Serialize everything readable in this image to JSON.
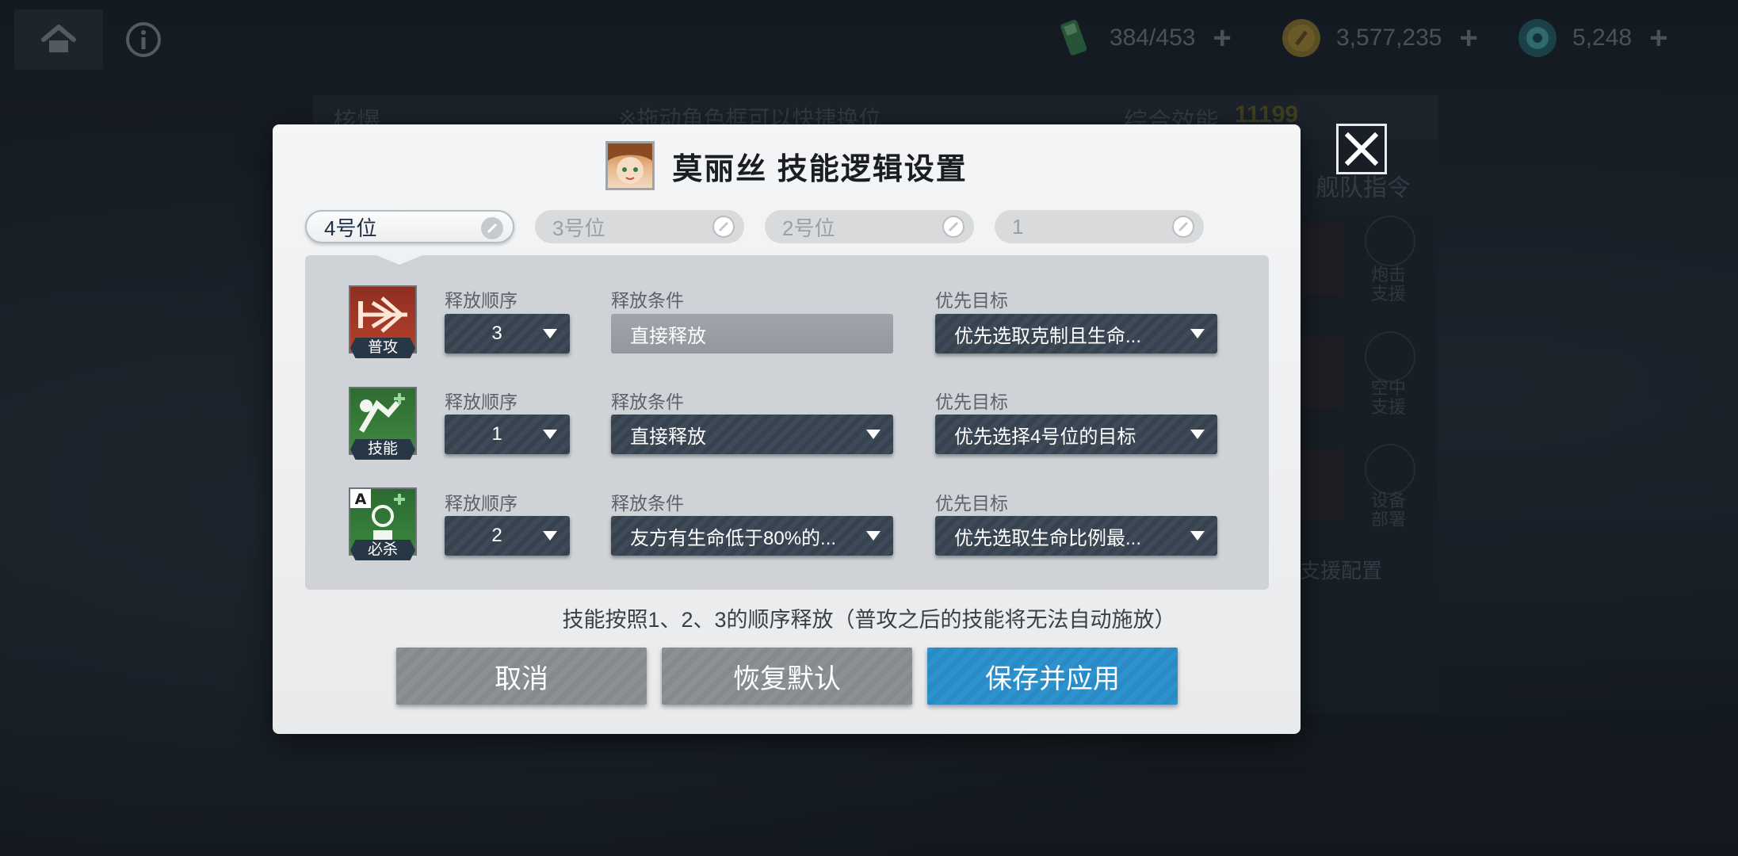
{
  "topbar": {
    "stamina": "384/453",
    "coins": "3,577,235",
    "gems": "5,248",
    "plus": "+"
  },
  "background": {
    "team_name": "核爆",
    "drag_hint": "※拖动角色框可以快捷换位",
    "power_label": "综合效能",
    "power_value": "11199",
    "team_command": "舰队指令",
    "support_config": "支援配置",
    "side_items": [
      "炮击支援",
      "空中支援",
      "设备部署"
    ]
  },
  "dialog": {
    "title": "莫丽丝  技能逻辑设置",
    "positions": [
      {
        "label": "4号位",
        "active": true
      },
      {
        "label": "3号位",
        "active": false
      },
      {
        "label": "2号位",
        "active": false
      },
      {
        "label": "1",
        "active": false
      }
    ],
    "column_labels": {
      "order": "释放顺序",
      "condition": "释放条件",
      "target": "优先目标"
    },
    "skills": [
      {
        "tag": "普攻",
        "order": "3",
        "condition": "直接释放",
        "condition_disabled": true,
        "target": "优先选取克制且生命..."
      },
      {
        "tag": "技能",
        "order": "1",
        "condition": "直接释放",
        "condition_disabled": false,
        "target": "优先选择4号位的目标"
      },
      {
        "tag": "必杀",
        "badge": "A",
        "order": "2",
        "condition": "友方有生命低于80%的...",
        "condition_disabled": false,
        "target": "优先选取生命比例最..."
      }
    ],
    "note": "技能按照1、2、3的顺序释放（普攻之后的技能将无法自动施放）",
    "buttons": {
      "cancel": "取消",
      "reset": "恢复默认",
      "save": "保存并应用"
    }
  },
  "colors": {
    "accent_blue": "#2d93cf",
    "dropdown_dark": "#3e4a58",
    "power_gold": "#c8b43a"
  }
}
